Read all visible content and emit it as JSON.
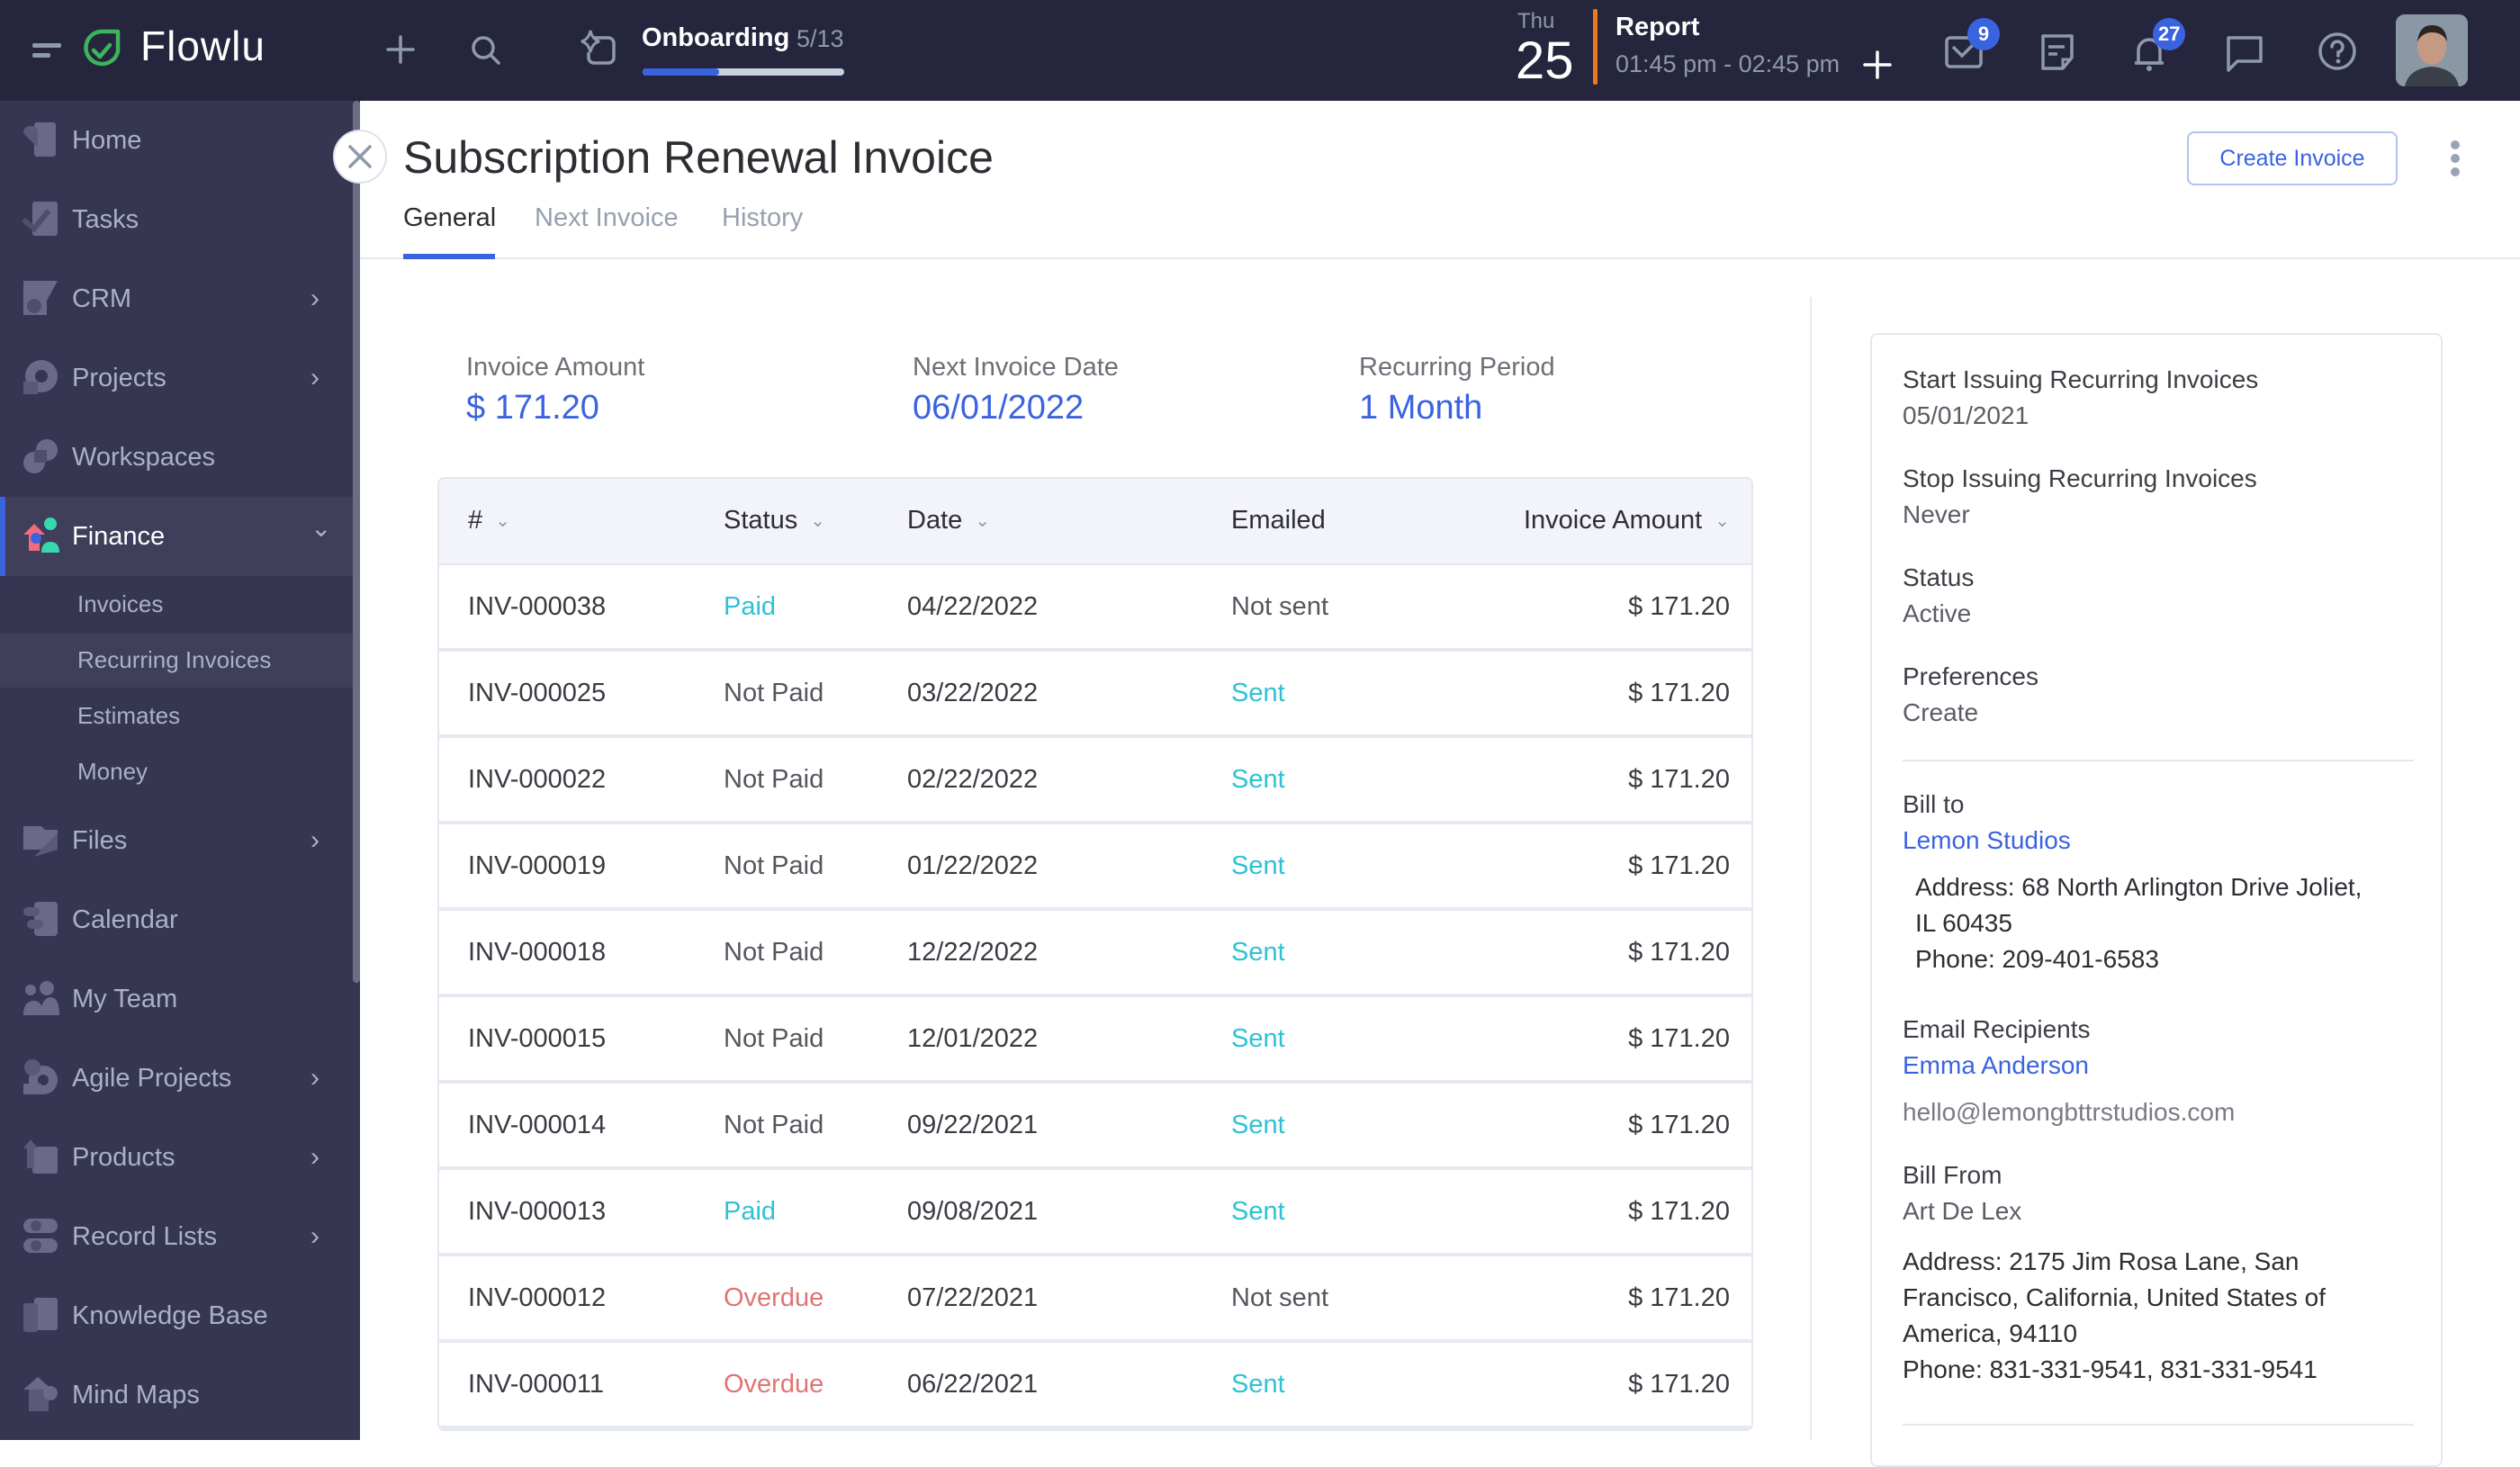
{
  "topbar": {
    "brand": "Flowlu",
    "onboarding": {
      "title": "Onboarding",
      "count": "5/13",
      "progress_fraction": 0.38
    },
    "calendar": {
      "weekday": "Thu",
      "day": "25"
    },
    "event": {
      "title": "Report",
      "time": "01:45 pm - 02:45 pm"
    },
    "badges": {
      "mail": "9",
      "notifications": "27"
    },
    "colors": {
      "accent": "#3a63e0",
      "event_bar": "#ea7a1f",
      "brand_green": "#3cb55a"
    }
  },
  "sidebar": {
    "items": [
      {
        "label": "Home",
        "icon": "home-icon",
        "chevron": ""
      },
      {
        "label": "Tasks",
        "icon": "tasks-icon",
        "chevron": ""
      },
      {
        "label": "CRM",
        "icon": "crm-icon",
        "chevron": "›"
      },
      {
        "label": "Projects",
        "icon": "projects-icon",
        "chevron": "›"
      },
      {
        "label": "Workspaces",
        "icon": "workspaces-icon",
        "chevron": ""
      },
      {
        "label": "Finance",
        "icon": "finance-icon",
        "chevron": "⌄",
        "active": true
      },
      {
        "label": "Files",
        "icon": "files-icon",
        "chevron": "›"
      },
      {
        "label": "Calendar",
        "icon": "calendar-icon",
        "chevron": ""
      },
      {
        "label": "My Team",
        "icon": "team-icon",
        "chevron": ""
      },
      {
        "label": "Agile Projects",
        "icon": "agile-icon",
        "chevron": "›"
      },
      {
        "label": "Products",
        "icon": "products-icon",
        "chevron": "›"
      },
      {
        "label": "Record Lists",
        "icon": "record-lists-icon",
        "chevron": "›"
      },
      {
        "label": "Knowledge Base",
        "icon": "knowledge-base-icon",
        "chevron": ""
      },
      {
        "label": "Mind Maps",
        "icon": "mind-maps-icon",
        "chevron": ""
      }
    ],
    "finance_sub": [
      {
        "label": "Invoices"
      },
      {
        "label": "Recurring Invoices",
        "selected": true
      },
      {
        "label": "Estimates"
      },
      {
        "label": "Money"
      }
    ]
  },
  "header": {
    "title": "Subscription Renewal Invoice",
    "tabs": [
      {
        "label": "General",
        "active": true
      },
      {
        "label": "Next Invoice"
      },
      {
        "label": "History"
      }
    ],
    "create_button": "Create Invoice"
  },
  "summary": [
    {
      "label": "Invoice Amount",
      "value": "$ 171.20"
    },
    {
      "label": "Next Invoice Date",
      "value": "06/01/2022"
    },
    {
      "label": "Recurring Period",
      "value": "1 Month"
    }
  ],
  "table": {
    "columns": [
      "#",
      "Status",
      "Date",
      "Emailed",
      "Invoice Amount"
    ],
    "rows": [
      {
        "number": "INV-000038",
        "status": "Paid",
        "date": "04/22/2022",
        "emailed": "Not sent",
        "amount": "$ 171.20"
      },
      {
        "number": "INV-000025",
        "status": "Not Paid",
        "date": "03/22/2022",
        "emailed": "Sent",
        "amount": "$ 171.20"
      },
      {
        "number": "INV-000022",
        "status": "Not Paid",
        "date": "02/22/2022",
        "emailed": "Sent",
        "amount": "$ 171.20"
      },
      {
        "number": "INV-000019",
        "status": "Not Paid",
        "date": "01/22/2022",
        "emailed": "Sent",
        "amount": "$ 171.20"
      },
      {
        "number": "INV-000018",
        "status": "Not Paid",
        "date": "12/22/2022",
        "emailed": "Sent",
        "amount": "$ 171.20"
      },
      {
        "number": "INV-000015",
        "status": "Not Paid",
        "date": "12/01/2022",
        "emailed": "Sent",
        "amount": "$ 171.20"
      },
      {
        "number": "INV-000014",
        "status": "Not Paid",
        "date": "09/22/2021",
        "emailed": "Sent",
        "amount": "$ 171.20"
      },
      {
        "number": "INV-000013",
        "status": "Paid",
        "date": "09/08/2021",
        "emailed": "Sent",
        "amount": "$ 171.20"
      },
      {
        "number": "INV-000012",
        "status": "Overdue",
        "date": "07/22/2021",
        "emailed": "Not sent",
        "amount": "$ 171.20"
      },
      {
        "number": "INV-000011",
        "status": "Overdue",
        "date": "06/22/2021",
        "emailed": "Sent",
        "amount": "$ 171.20"
      }
    ],
    "status_colors": {
      "Paid": "#2ec1d6",
      "Not Paid": "#55555e",
      "Overdue": "#e07474",
      "Sent": "#2ec1d6",
      "Not sent": "#55555e"
    }
  },
  "details": {
    "start_label": "Start Issuing Recurring Invoices",
    "start_value": "05/01/2021",
    "stop_label": "Stop Issuing Recurring Invoices",
    "stop_value": "Never",
    "status_label": "Status",
    "status_value": "Active",
    "preferences_label": "Preferences",
    "preferences_value": "Create",
    "bill_to_label": "Bill to",
    "bill_to_name": "Lemon Studios",
    "bill_to_address_1": "Address: 68 North Arlington Drive Joliet,",
    "bill_to_address_2": "IL 60435",
    "bill_to_phone": "Phone: 209-401-6583",
    "email_label": "Email Recipients",
    "email_name": "Emma Anderson",
    "email_address": "hello@lemongbttrstudios.com",
    "bill_from_label": "Bill From",
    "bill_from_name": "Art De Lex",
    "bill_from_address_1": "Address: 2175 Jim Rosa Lane, San",
    "bill_from_address_2": "Francisco, California, United States of",
    "bill_from_address_3": "America, 94110",
    "bill_from_phone": "Phone: 831-331-9541, 831-331-9541"
  }
}
